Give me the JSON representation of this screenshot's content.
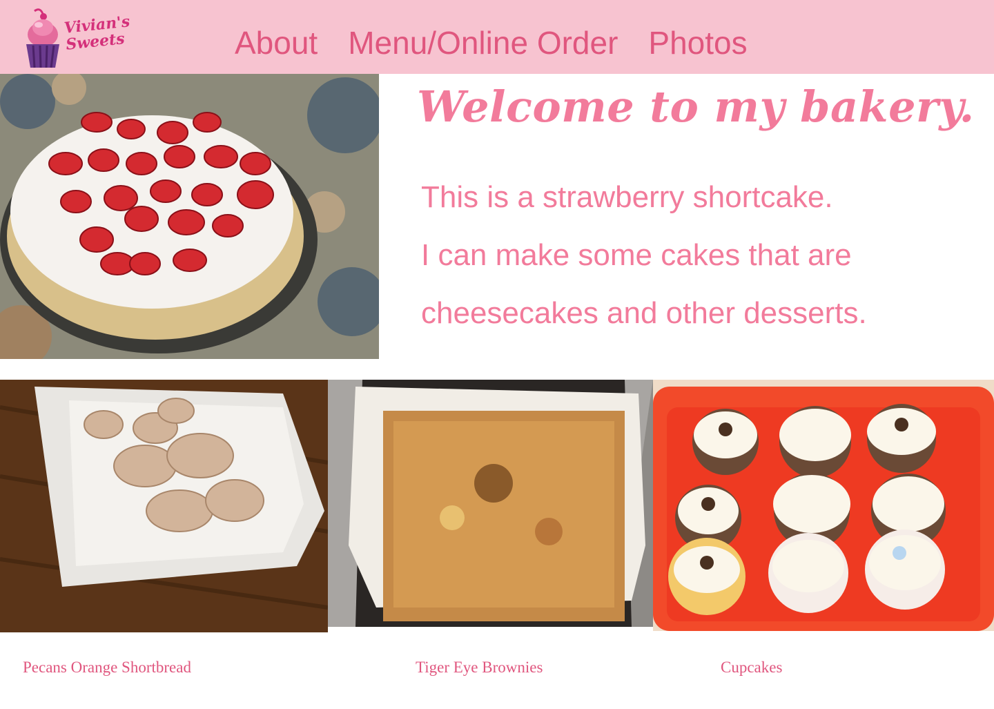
{
  "brand": {
    "line1": "Vivian's",
    "line2": "Sweets",
    "colors": {
      "header_bg": "#f7c3d0",
      "accent": "#e0567e",
      "text_pink": "#f27b9b"
    }
  },
  "nav": {
    "items": [
      {
        "label": "About"
      },
      {
        "label": "Menu/Online Order"
      },
      {
        "label": "Photos"
      }
    ]
  },
  "hero": {
    "heading": "Welcome to my bakery.",
    "lines": [
      "This is a strawberry shortcake.",
      "I can make some cakes that are",
      "cheesecakes and other desserts."
    ]
  },
  "gallery": [
    {
      "caption": "Pecans Orange Shortbread"
    },
    {
      "caption": "Tiger Eye Brownies"
    },
    {
      "caption": "Cupcakes"
    }
  ]
}
